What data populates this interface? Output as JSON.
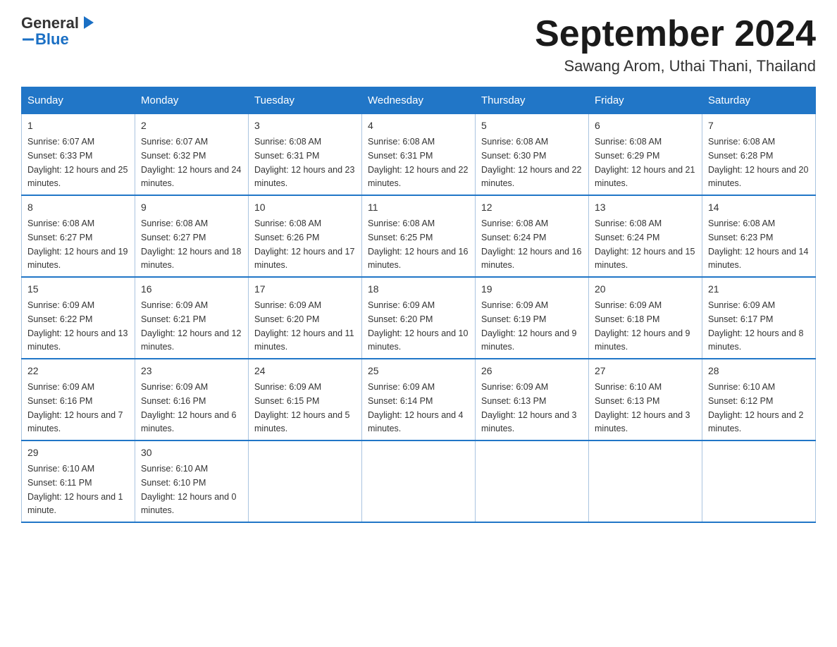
{
  "header": {
    "logo_general": "General",
    "logo_blue": "Blue",
    "month_title": "September 2024",
    "subtitle": "Sawang Arom, Uthai Thani, Thailand"
  },
  "days_of_week": [
    "Sunday",
    "Monday",
    "Tuesday",
    "Wednesday",
    "Thursday",
    "Friday",
    "Saturday"
  ],
  "weeks": [
    [
      {
        "day": "1",
        "sunrise": "6:07 AM",
        "sunset": "6:33 PM",
        "daylight": "12 hours and 25 minutes."
      },
      {
        "day": "2",
        "sunrise": "6:07 AM",
        "sunset": "6:32 PM",
        "daylight": "12 hours and 24 minutes."
      },
      {
        "day": "3",
        "sunrise": "6:08 AM",
        "sunset": "6:31 PM",
        "daylight": "12 hours and 23 minutes."
      },
      {
        "day": "4",
        "sunrise": "6:08 AM",
        "sunset": "6:31 PM",
        "daylight": "12 hours and 22 minutes."
      },
      {
        "day": "5",
        "sunrise": "6:08 AM",
        "sunset": "6:30 PM",
        "daylight": "12 hours and 22 minutes."
      },
      {
        "day": "6",
        "sunrise": "6:08 AM",
        "sunset": "6:29 PM",
        "daylight": "12 hours and 21 minutes."
      },
      {
        "day": "7",
        "sunrise": "6:08 AM",
        "sunset": "6:28 PM",
        "daylight": "12 hours and 20 minutes."
      }
    ],
    [
      {
        "day": "8",
        "sunrise": "6:08 AM",
        "sunset": "6:27 PM",
        "daylight": "12 hours and 19 minutes."
      },
      {
        "day": "9",
        "sunrise": "6:08 AM",
        "sunset": "6:27 PM",
        "daylight": "12 hours and 18 minutes."
      },
      {
        "day": "10",
        "sunrise": "6:08 AM",
        "sunset": "6:26 PM",
        "daylight": "12 hours and 17 minutes."
      },
      {
        "day": "11",
        "sunrise": "6:08 AM",
        "sunset": "6:25 PM",
        "daylight": "12 hours and 16 minutes."
      },
      {
        "day": "12",
        "sunrise": "6:08 AM",
        "sunset": "6:24 PM",
        "daylight": "12 hours and 16 minutes."
      },
      {
        "day": "13",
        "sunrise": "6:08 AM",
        "sunset": "6:24 PM",
        "daylight": "12 hours and 15 minutes."
      },
      {
        "day": "14",
        "sunrise": "6:08 AM",
        "sunset": "6:23 PM",
        "daylight": "12 hours and 14 minutes."
      }
    ],
    [
      {
        "day": "15",
        "sunrise": "6:09 AM",
        "sunset": "6:22 PM",
        "daylight": "12 hours and 13 minutes."
      },
      {
        "day": "16",
        "sunrise": "6:09 AM",
        "sunset": "6:21 PM",
        "daylight": "12 hours and 12 minutes."
      },
      {
        "day": "17",
        "sunrise": "6:09 AM",
        "sunset": "6:20 PM",
        "daylight": "12 hours and 11 minutes."
      },
      {
        "day": "18",
        "sunrise": "6:09 AM",
        "sunset": "6:20 PM",
        "daylight": "12 hours and 10 minutes."
      },
      {
        "day": "19",
        "sunrise": "6:09 AM",
        "sunset": "6:19 PM",
        "daylight": "12 hours and 9 minutes."
      },
      {
        "day": "20",
        "sunrise": "6:09 AM",
        "sunset": "6:18 PM",
        "daylight": "12 hours and 9 minutes."
      },
      {
        "day": "21",
        "sunrise": "6:09 AM",
        "sunset": "6:17 PM",
        "daylight": "12 hours and 8 minutes."
      }
    ],
    [
      {
        "day": "22",
        "sunrise": "6:09 AM",
        "sunset": "6:16 PM",
        "daylight": "12 hours and 7 minutes."
      },
      {
        "day": "23",
        "sunrise": "6:09 AM",
        "sunset": "6:16 PM",
        "daylight": "12 hours and 6 minutes."
      },
      {
        "day": "24",
        "sunrise": "6:09 AM",
        "sunset": "6:15 PM",
        "daylight": "12 hours and 5 minutes."
      },
      {
        "day": "25",
        "sunrise": "6:09 AM",
        "sunset": "6:14 PM",
        "daylight": "12 hours and 4 minutes."
      },
      {
        "day": "26",
        "sunrise": "6:09 AM",
        "sunset": "6:13 PM",
        "daylight": "12 hours and 3 minutes."
      },
      {
        "day": "27",
        "sunrise": "6:10 AM",
        "sunset": "6:13 PM",
        "daylight": "12 hours and 3 minutes."
      },
      {
        "day": "28",
        "sunrise": "6:10 AM",
        "sunset": "6:12 PM",
        "daylight": "12 hours and 2 minutes."
      }
    ],
    [
      {
        "day": "29",
        "sunrise": "6:10 AM",
        "sunset": "6:11 PM",
        "daylight": "12 hours and 1 minute."
      },
      {
        "day": "30",
        "sunrise": "6:10 AM",
        "sunset": "6:10 PM",
        "daylight": "12 hours and 0 minutes."
      },
      null,
      null,
      null,
      null,
      null
    ]
  ]
}
